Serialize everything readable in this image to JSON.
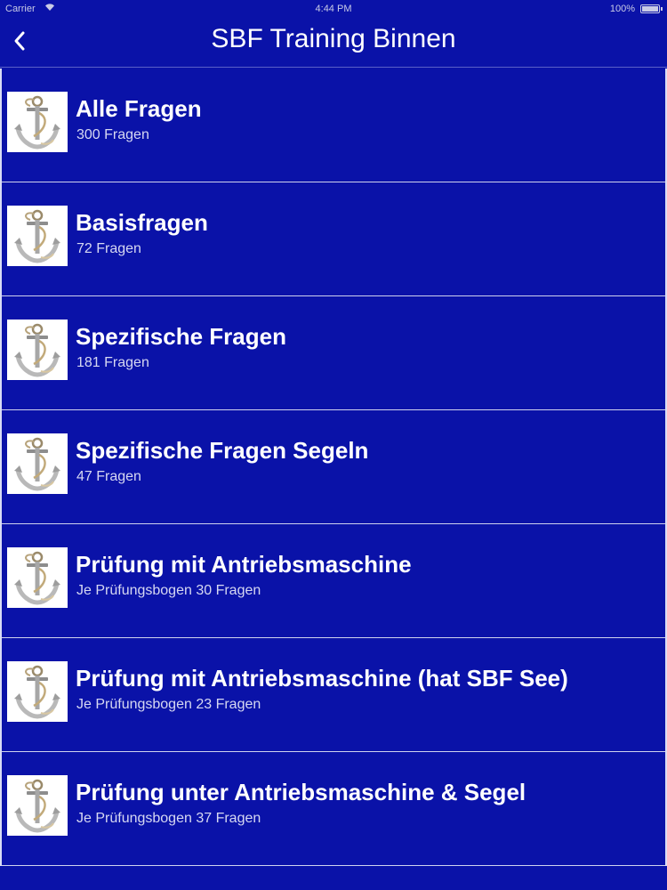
{
  "status_bar": {
    "carrier": "Carrier",
    "time": "4:44 PM",
    "battery": "100%"
  },
  "nav": {
    "title": "SBF Training Binnen",
    "back_icon": "chevron-left-icon"
  },
  "colors": {
    "background": "#0a12a8",
    "separator": "#cfd2ee"
  },
  "items": [
    {
      "title": "Alle Fragen",
      "subtitle": "300 Fragen"
    },
    {
      "title": "Basisfragen",
      "subtitle": "72 Fragen"
    },
    {
      "title": "Spezifische Fragen",
      "subtitle": "181 Fragen"
    },
    {
      "title": "Spezifische Fragen Segeln",
      "subtitle": "47 Fragen"
    },
    {
      "title": "Prüfung mit Antriebsmaschine",
      "subtitle": "Je Prüfungsbogen 30 Fragen"
    },
    {
      "title": "Prüfung mit Antriebsmaschine (hat SBF See)",
      "subtitle": "Je Prüfungsbogen 23 Fragen"
    },
    {
      "title": "Prüfung unter Antriebsmaschine & Segel",
      "subtitle": "Je Prüfungsbogen 37 Fragen"
    }
  ]
}
